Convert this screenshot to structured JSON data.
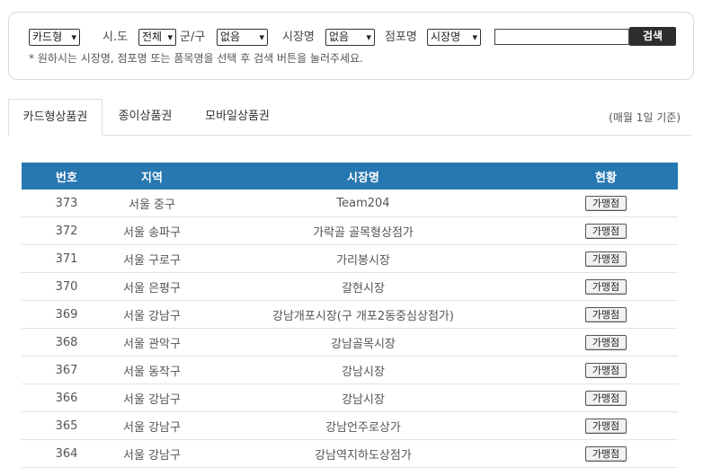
{
  "search": {
    "type_select": "카드형",
    "sido_label": "시.도",
    "sido_select": "전체",
    "gugun_label": "군/구",
    "gugun_select": "없음",
    "market_label": "시장명",
    "market_select": "없음",
    "store_label": "점포명",
    "store_select": "시장명",
    "keyword_value": "",
    "button_label": "검색",
    "hint": "* 원하시는 시장명, 점포명 또는 품목명을 선택 후 검색 버튼을 눌러주세요."
  },
  "tabs": [
    {
      "label": "카드형상품권",
      "active": true
    },
    {
      "label": "종이상품권",
      "active": false
    },
    {
      "label": "모바일상품권",
      "active": false
    }
  ],
  "update_note": "(매월 1일 기준)",
  "table": {
    "headers": [
      "번호",
      "지역",
      "시장명",
      "현황"
    ],
    "rows": [
      {
        "no": "373",
        "region": "서울 중구",
        "market": "Team204",
        "action": "가맹점"
      },
      {
        "no": "372",
        "region": "서울 송파구",
        "market": "가락골 골목형상점가",
        "action": "가맹점"
      },
      {
        "no": "371",
        "region": "서울 구로구",
        "market": "가리봉시장",
        "action": "가맹점"
      },
      {
        "no": "370",
        "region": "서울 은평구",
        "market": "갈현시장",
        "action": "가맹점"
      },
      {
        "no": "369",
        "region": "서울 강남구",
        "market": "강남개포시장(구 개포2동중심상점가)",
        "action": "가맹점"
      },
      {
        "no": "368",
        "region": "서울 관악구",
        "market": "강남골목시장",
        "action": "가맹점"
      },
      {
        "no": "367",
        "region": "서울 동작구",
        "market": "강남시장",
        "action": "가맹점"
      },
      {
        "no": "366",
        "region": "서울 강남구",
        "market": "강남시장",
        "action": "가맹점"
      },
      {
        "no": "365",
        "region": "서울 강남구",
        "market": "강남언주로상가",
        "action": "가맹점"
      },
      {
        "no": "364",
        "region": "서울 강남구",
        "market": "강남역지하도상점가",
        "action": "가맹점"
      }
    ]
  }
}
